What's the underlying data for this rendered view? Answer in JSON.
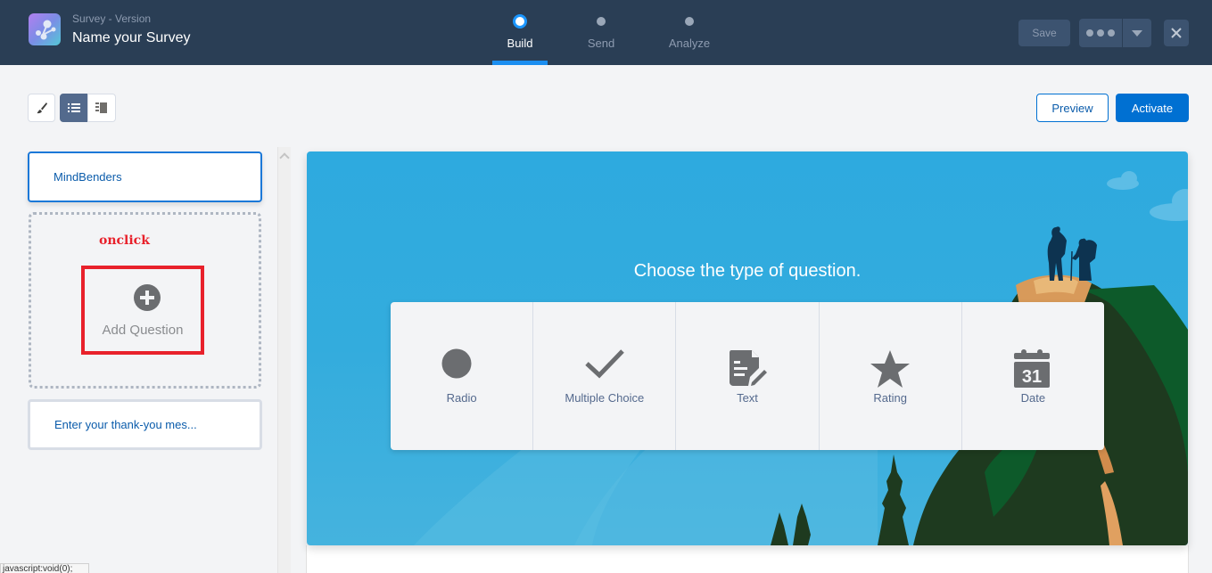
{
  "header": {
    "subtitle": "Survey - Version",
    "title": "Name your Survey",
    "steps": [
      {
        "label": "Build",
        "active": true
      },
      {
        "label": "Send",
        "active": false
      },
      {
        "label": "Analyze",
        "active": false
      }
    ],
    "save_label": "Save",
    "more_icon": "more-icon",
    "dropdown_icon": "chevron-down-icon",
    "close_icon": "close-icon"
  },
  "toolbar": {
    "tools": [
      "brush-icon",
      "list-icon",
      "page-layout-icon"
    ],
    "preview_label": "Preview",
    "activate_label": "Activate"
  },
  "left_panel": {
    "welcome_page": "MindBenders",
    "annotation": "onclick",
    "add_question_label": "Add Question",
    "thank_you_page": "Enter your thank-you mes..."
  },
  "canvas": {
    "prompt": "Choose the type of question.",
    "question_types": [
      {
        "label": "Radio",
        "icon": "radio-icon"
      },
      {
        "label": "Multiple Choice",
        "icon": "checkmark-icon"
      },
      {
        "label": "Text",
        "icon": "text-document-icon"
      },
      {
        "label": "Rating",
        "icon": "star-icon"
      },
      {
        "label": "Date",
        "icon": "calendar-icon",
        "icon_text": "31"
      }
    ]
  },
  "status_bar": {
    "text": "javascript:void(0);"
  },
  "colors": {
    "header_bg": "#2a3e55",
    "brand_blue": "#0070d2",
    "annotation_red": "#e8212b",
    "hero_sky": "#2eaadf"
  }
}
